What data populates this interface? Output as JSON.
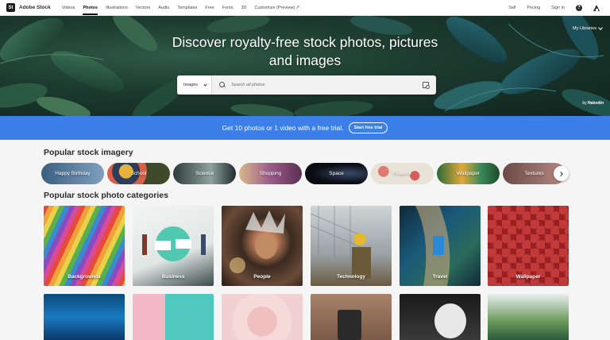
{
  "nav": {
    "brand_mark": "St",
    "brand": "Adobe Stock",
    "links": [
      "Videos",
      "Photos",
      "Illustrations",
      "Vectors",
      "Audio",
      "Templates",
      "Free",
      "Fonts",
      "3D",
      "Customize (Preview)"
    ],
    "active": "Photos",
    "right": {
      "sell": "Sell",
      "pricing": "Pricing",
      "sign_in": "Sign in",
      "help": "?"
    }
  },
  "hero": {
    "title": "Discover royalty-free stock photos, pictures and images",
    "libraries": "My Libraries",
    "credit_prefix": "by",
    "credit_name": "Nabodin"
  },
  "search": {
    "type": "Images",
    "placeholder": "Search all photos"
  },
  "promo": {
    "text": "Get 10 photos or 1 video with a free trial.",
    "button": "Start free trial"
  },
  "popular_imagery": {
    "title": "Popular stock imagery",
    "pills": [
      "Happy Birthday",
      "School",
      "Science",
      "Shopping",
      "Space",
      "Flowers",
      "Wallpaper",
      "Textures"
    ]
  },
  "categories": {
    "title": "Popular stock photo categories",
    "items": [
      "Backgrounds",
      "Business",
      "People",
      "Technology",
      "Travel",
      "Wallpaper"
    ]
  },
  "colors": {
    "promo": "#3d7fe8",
    "hero": "#1d3b30"
  }
}
